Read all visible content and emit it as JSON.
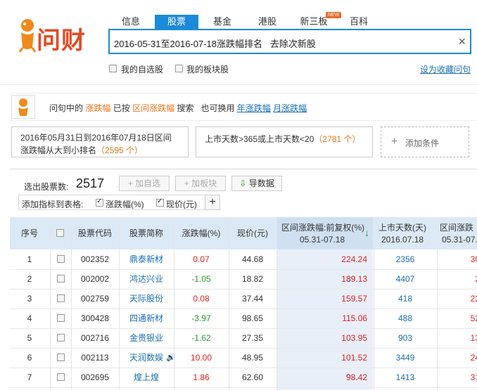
{
  "nav": {
    "tabs": [
      "信息",
      "股票",
      "基金",
      "港股",
      "新三板",
      "百科"
    ],
    "active_tab": "股票",
    "new_badge": "NEW"
  },
  "logo": {
    "text": "问财"
  },
  "search": {
    "query": "2016-05-31至2016-07-18涨跌幅排名   去除次新股",
    "clear_icon": "×"
  },
  "options": {
    "my_stocks": "我的自选股",
    "my_sectors": "我的板块股",
    "save_link": "设为收藏问句"
  },
  "hint": {
    "prefix": "问句中的",
    "word": "涨跌幅",
    "mid": "已按",
    "range_word": "区间涨跌幅",
    "suffix": "搜索   也可换用",
    "alt1": "年涨跌幅",
    "alt2": "月涨跌幅"
  },
  "conditions": {
    "cond1_line1": "2016年05月31日到2016年07月18日区间",
    "cond1_line2": "涨跌幅从大到小排名",
    "cond1_count": "（2595 个）",
    "cond2_text": "上市天数>365或上市天数<20",
    "cond2_count": "（2781 个）",
    "add_label": "添加条件",
    "add_icon": "+"
  },
  "toolbar": {
    "selected_label": "选出股票数:",
    "selected_count": "2517",
    "add_watch": "加自选",
    "add_sector": "加板块",
    "export": "导数据",
    "add_col_label": "添加指标到表格:",
    "col1": "涨跌幅(%)",
    "col2": "现价(元)",
    "plus": "+"
  },
  "table": {
    "headers": {
      "idx": "序号",
      "code": "股票代码",
      "name": "股票简称",
      "chg": "涨跌幅(%)",
      "price": "现价(元)",
      "range_chg": "区间涨跌幅:前复权(%)",
      "range_chg_sub": "05.31-07.18",
      "sort_icon": "↓",
      "days": "上市天数(天)",
      "days_sub": "2016.07.18",
      "range_chg2": "区间涨跌",
      "range_chg2_sub": "05.31-07."
    },
    "rows": [
      {
        "idx": "1",
        "code": "002352",
        "name": "鼎泰新材",
        "chg": "0.07",
        "price": "44.68",
        "range": "224.24",
        "days": "2356",
        "r2": "30"
      },
      {
        "idx": "2",
        "code": "002002",
        "name": "鸿达兴业",
        "chg": "-1.05",
        "price": "18.82",
        "range": "189.13",
        "days": "4407",
        "r2": "2"
      },
      {
        "idx": "3",
        "code": "002759",
        "name": "天际股份",
        "chg": "0.08",
        "price": "37.44",
        "range": "159.57",
        "days": "418",
        "r2": "23"
      },
      {
        "idx": "4",
        "code": "300428",
        "name": "四通新材",
        "chg": "-3.97",
        "price": "98.65",
        "range": "115.06",
        "days": "488",
        "r2": "52"
      },
      {
        "idx": "5",
        "code": "002716",
        "name": "金贵银业",
        "chg": "-1.62",
        "price": "27.35",
        "range": "103.95",
        "days": "903",
        "r2": "13"
      },
      {
        "idx": "6",
        "code": "002113",
        "name": "天润数娱",
        "chg": "10.00",
        "price": "48.95",
        "range": "101.52",
        "days": "3449",
        "r2": "24"
      },
      {
        "idx": "7",
        "code": "002695",
        "name": "煌上煌",
        "chg": "1.86",
        "price": "62.60",
        "range": "98.42",
        "days": "1413",
        "r2": "31"
      }
    ]
  },
  "colors": {
    "accent": "#1b8ad9",
    "brand": "#e24a24",
    "up": "#e02020",
    "down": "#2a9a2a"
  }
}
